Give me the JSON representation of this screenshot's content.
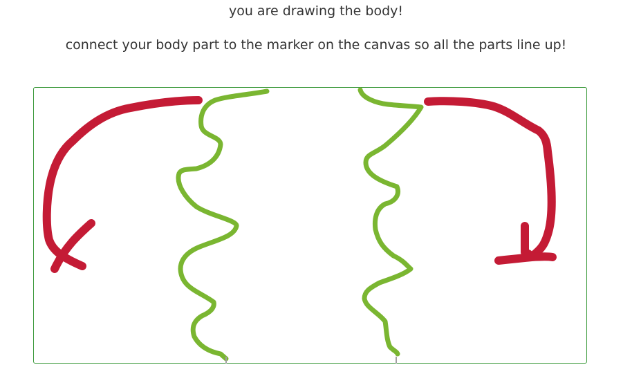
{
  "instructions": {
    "line1": "you are drawing the body!",
    "line2": "connect your body part to the marker on the canvas so all the parts line up!"
  },
  "canvas": {
    "border_color": "#3c9a3c",
    "stroke_colors": {
      "body_outline": "#7ab631",
      "arrow": "#c41b35",
      "marker": "#a0a0a0"
    }
  }
}
